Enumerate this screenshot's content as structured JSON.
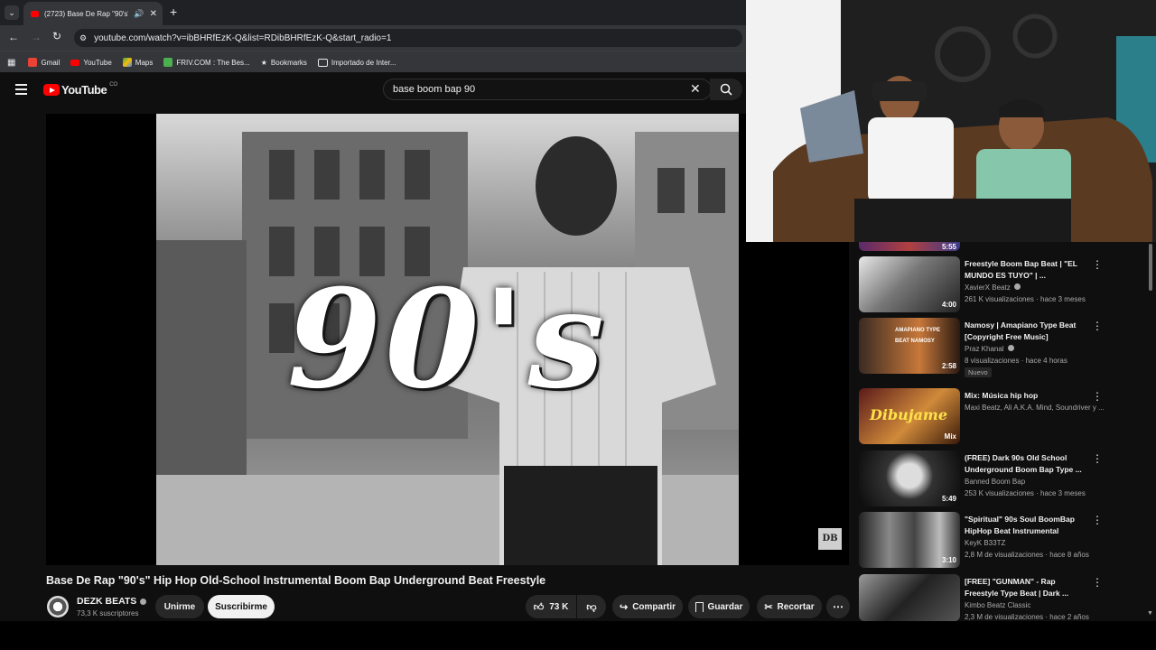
{
  "browser": {
    "tab_title": "(2723) Base De Rap \"90's\" |",
    "url": "youtube.com/watch?v=ibBHRfEzK-Q&list=RDibBHRfEzK-Q&start_radio=1",
    "bookmarks": [
      "Gmail",
      "YouTube",
      "Maps",
      "FRIV.COM : The Bes...",
      "Bookmarks",
      "Importado de Inter..."
    ]
  },
  "youtube": {
    "logo_text": "YouTube",
    "country_code": "CO",
    "search_value": "base boom bap 90"
  },
  "video": {
    "overlay_text": "90's",
    "watermark": "DB",
    "title": "Base De Rap \"90's\" Hip Hop Old-School Instrumental Boom Bap Underground Beat Freestyle"
  },
  "channel": {
    "name": "DEZK BEATS",
    "subscribers": "73,3 K suscriptores",
    "join_label": "Unirme",
    "subscribe_label": "Suscribirme"
  },
  "actions": {
    "likes": "73 K",
    "share": "Compartir",
    "save": "Guardar",
    "clip": "Recortar"
  },
  "sidebar": {
    "partial_duration": "5:55",
    "items": [
      {
        "title": "Freestyle Boom Bap Beat | \"EL MUNDO ES TUYO\" | ...",
        "channel": "XavierX Beatz",
        "verified": true,
        "meta": "261 K visualizaciones · hace 3 meses",
        "duration": "4:00",
        "badge": ""
      },
      {
        "title": "Namosy | Amapiano Type Beat [Copyright Free Music]",
        "channel": "Praz Khanal",
        "verified": true,
        "meta": "8 visualizaciones · hace 4 horas",
        "duration": "2:58",
        "badge": "Nuevo",
        "thumb_text": "AMAPIANO TYPE BEAT NAMOSY"
      },
      {
        "title": "Mix: Música hip hop",
        "channel": "Maxi Beatz, Ali A.K.A. Mind, Soundriver y ...",
        "verified": false,
        "meta": "",
        "duration": "Mix",
        "badge": "",
        "thumb_text": "Dibujame"
      },
      {
        "title": "(FREE) Dark 90s Old School Underground Boom Bap Type ...",
        "channel": "Banned Boom Bap",
        "verified": false,
        "meta": "253 K visualizaciones · hace 3 meses",
        "duration": "5:49",
        "badge": ""
      },
      {
        "title": "\"Spiritual\" 90s Soul BoomBap HipHop Beat Instrumental",
        "channel": "KeyK B33TZ",
        "verified": false,
        "meta": "2,8 M de visualizaciones · hace 8 años",
        "duration": "3:10",
        "badge": ""
      },
      {
        "title": "[FREE] \"GUNMAN\" - Rap Freestyle Type Beat | Dark ...",
        "channel": "Kimbo Beatz Classic",
        "verified": false,
        "meta": "2,3 M de visualizaciones · hace 2 años",
        "duration": "",
        "badge": ""
      }
    ]
  },
  "colors": {
    "background": "#0f0f0f",
    "youtube_red": "#ff0000",
    "chrome_dark": "#202124",
    "chrome_mid": "#35363a"
  }
}
